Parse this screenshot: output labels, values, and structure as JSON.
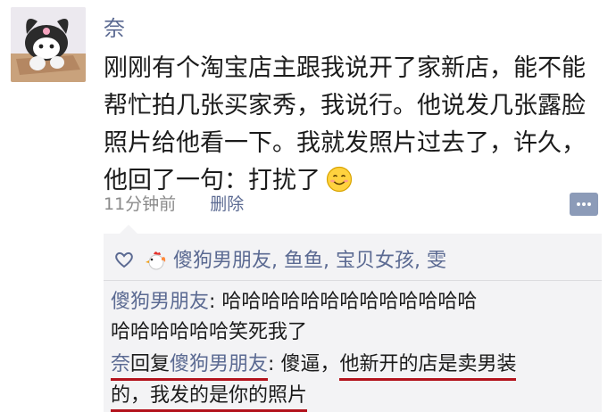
{
  "post": {
    "author": "奈",
    "text_lines": [
      "刚刚有个淘宝店主跟我说开了家新店，能不能",
      "帮忙拍几张买家秀，我说行。他说发几张露脸",
      "照片给他看一下。我就发照片过去了，许久，",
      "他回了一句：打扰了"
    ],
    "time": "11分钟前",
    "delete_label": "删除"
  },
  "likes": {
    "names": "傻狗男朋友, 鱼鱼, 宝贝女孩, 雯"
  },
  "comments": [
    {
      "author": "傻狗男朋友",
      "separator": ": ",
      "line1": "哈哈哈哈哈哈哈哈哈哈哈哈哈",
      "line2": "哈哈哈哈哈哈笑死我了"
    },
    {
      "author": "奈",
      "reply_word": "回复",
      "reply_to": "傻狗男朋友",
      "separator": ": ",
      "text_a": "傻逼，",
      "text_b": "他新开的店是卖男装",
      "line2": "的，我发的是你的照片"
    }
  ],
  "colors": {
    "name_link": "#5b6a92",
    "underline": "#b3121c",
    "panel_bg": "#f3f3f5"
  }
}
